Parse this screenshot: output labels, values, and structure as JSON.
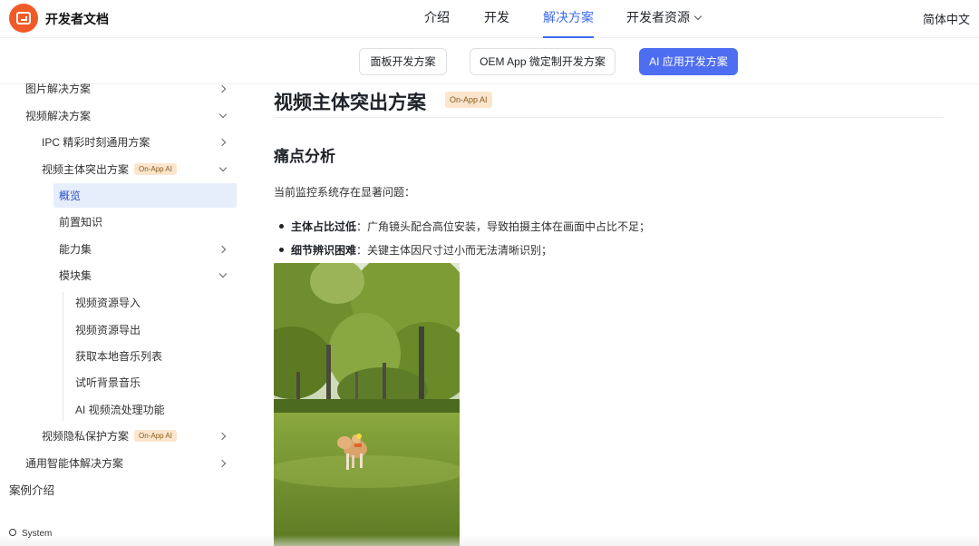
{
  "header": {
    "brand": "开发者文档",
    "nav": [
      {
        "label": "介绍"
      },
      {
        "label": "开发"
      },
      {
        "label": "解决方案"
      },
      {
        "label": "开发者资源"
      }
    ],
    "language": "简体中文"
  },
  "subnav": {
    "pills": [
      {
        "label": "面板开发方案"
      },
      {
        "label": "OEM App 微定制开发方案"
      },
      {
        "label": "AI 应用开发方案"
      }
    ]
  },
  "sidebar": {
    "items": [
      {
        "label": "图片解决方案"
      },
      {
        "label": "视频解决方案"
      },
      {
        "label": "IPC 精彩时刻通用方案"
      },
      {
        "label": "视频主体突出方案",
        "tag": "On-App AI"
      },
      {
        "label": "概览"
      },
      {
        "label": "前置知识"
      },
      {
        "label": "能力集"
      },
      {
        "label": "模块集"
      },
      {
        "label": "视频资源导入"
      },
      {
        "label": "视频资源导出"
      },
      {
        "label": "获取本地音乐列表"
      },
      {
        "label": "试听背景音乐"
      },
      {
        "label": "AI 视频流处理功能"
      },
      {
        "label": "视频隐私保护方案",
        "tag": "On-App AI"
      },
      {
        "label": "通用智能体解决方案"
      },
      {
        "label": "案例介绍"
      }
    ],
    "theme_label": "System"
  },
  "content": {
    "title": "视频主体突出方案",
    "title_tag": "On-App AI",
    "section_heading": "痛点分析",
    "intro": "当前监控系统存在显著问题：",
    "bullets": [
      {
        "bold": "主体占比过低",
        "text": "：广角镜头配合高位安装，导致拍摄主体在画面中占比不足；"
      },
      {
        "bold": "细节辨识困难",
        "text": "：关键主体因尺寸过小而无法清晰识别；"
      }
    ]
  },
  "colors": {
    "accent": "#3d6bf0",
    "pill_active": "#4e6ef2",
    "logo": "#f05a28",
    "tag_bg": "#fbe6cd",
    "sidebar_active_bg": "#e6eefc"
  }
}
